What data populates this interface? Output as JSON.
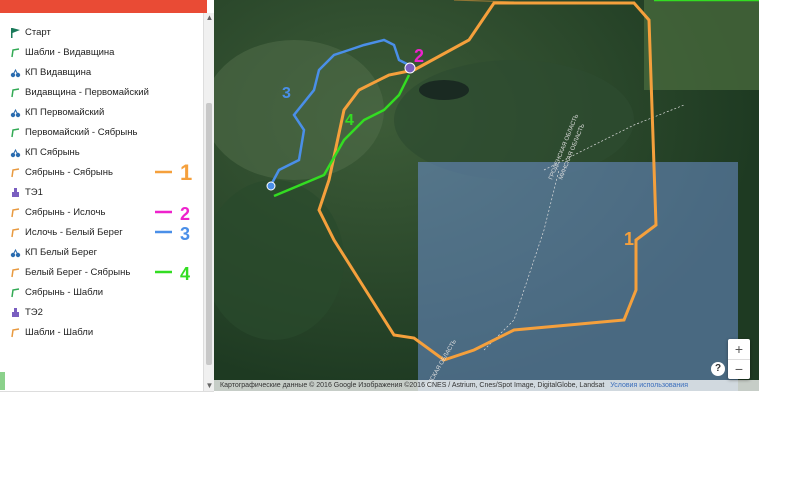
{
  "sidebar": {
    "items": [
      {
        "label": "Старт",
        "icon": "flag-icon"
      },
      {
        "label": "Шабли - Видавщина",
        "icon": "route-icon"
      },
      {
        "label": "КП Видавщина",
        "icon": "checkpoint-icon"
      },
      {
        "label": "Видавщина - Первомайский",
        "icon": "route-icon"
      },
      {
        "label": "КП Первомайский",
        "icon": "checkpoint-icon"
      },
      {
        "label": "Первомайский - Сябрынь",
        "icon": "route-icon"
      },
      {
        "label": "КП Сябрынь",
        "icon": "checkpoint-icon"
      },
      {
        "label": "Сябрынь - Сябрынь",
        "icon": "route-icon"
      },
      {
        "label": "ТЭ1",
        "icon": "transition-icon"
      },
      {
        "label": "Сябрынь - Ислочь",
        "icon": "route-icon"
      },
      {
        "label": "Ислочь - Белый Берег",
        "icon": "route-icon"
      },
      {
        "label": "КП Белый Берег",
        "icon": "checkpoint-icon"
      },
      {
        "label": "Белый Берег - Сябрынь",
        "icon": "route-icon"
      },
      {
        "label": "Сябрынь - Шабли",
        "icon": "route-icon"
      },
      {
        "label": "ТЭ2",
        "icon": "transition-icon"
      },
      {
        "label": "Шабли - Шабли",
        "icon": "route-icon"
      }
    ]
  },
  "annotations": {
    "one": "1",
    "two": "2",
    "three": "3",
    "four": "4",
    "orange": "#f5a03c",
    "magenta": "#ee22cc",
    "blue": "#4a8fe8",
    "green": "#33dd22"
  },
  "map": {
    "region_label_1": "ГРОДЕНСКАЯ ОБЛАСТЬ",
    "region_label_2": "МИНСКАЯ ОБЛАСТЬ",
    "region_label_3": "ЕНСКАЯ ОБЛАСТЬ",
    "attribution": "Картографические данные © 2016 Google Изображения ©2016 CNES / Astrium, Cnes/Spot Image, DigitalGlobe, Landsat",
    "terms": "Условия использования",
    "zoom_in": "+",
    "zoom_out": "−",
    "help": "?"
  }
}
